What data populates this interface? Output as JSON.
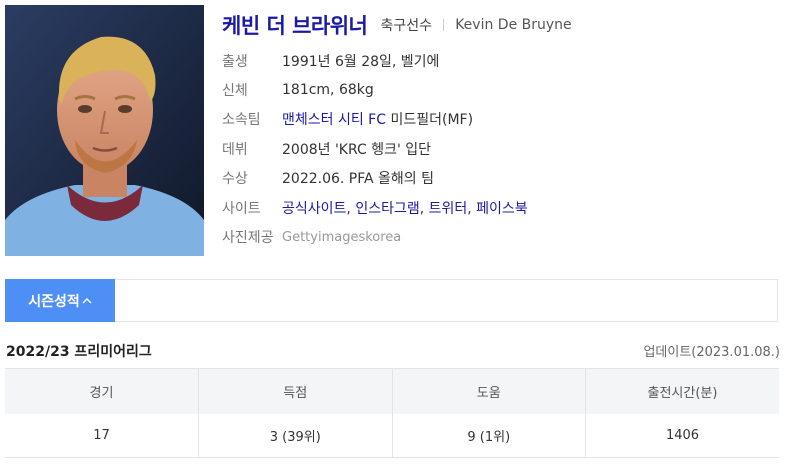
{
  "player": {
    "name": "케빈 더 브라위너",
    "job": "축구선수",
    "name_en": "Kevin De Bruyne"
  },
  "info": {
    "birth_label": "출생",
    "birth_value": "1991년 6월 28일, 벨기에",
    "body_label": "신체",
    "body_value": "181cm, 68kg",
    "team_label": "소속팀",
    "team_link": "맨체스터 시티 FC",
    "team_position": "미드필더(MF)",
    "debut_label": "데뷔",
    "debut_value": "2008년 'KRC 헹크' 입단",
    "award_label": "수상",
    "award_value": "2022.06. PFA 올해의 팀",
    "site_label": "사이트",
    "sites": [
      "공식사이트",
      "인스타그램",
      "트위터",
      "페이스북"
    ],
    "photo_label": "사진제공",
    "photo_value": "Gettyimageskorea"
  },
  "tabs": {
    "season_stats": "시즌성적",
    "season_stats_icon": "chevron-up-icon"
  },
  "season": {
    "league": "2022/23 프리미어리그",
    "updated": "업데이트(2023.01.08.)",
    "headers": [
      "경기",
      "득점",
      "도움",
      "출전시간(분)"
    ],
    "row": [
      "17",
      "3 (39위)",
      "9 (1위)",
      "1406"
    ]
  },
  "colors": {
    "name": "#1a1aa6",
    "tab_active": "#4e8ff5",
    "table_header_bg": "#f4f5f7"
  }
}
